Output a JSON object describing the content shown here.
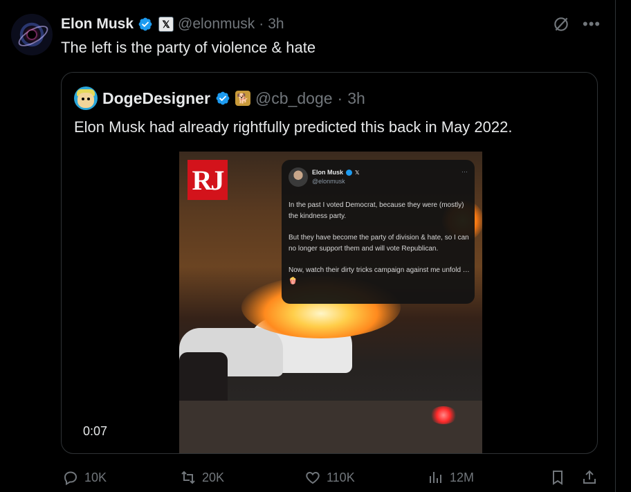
{
  "tweet": {
    "author_name": "Elon Musk",
    "handle": "@elonmusk",
    "separator": "·",
    "time": "3h",
    "affiliation_badge": "𝕏",
    "text": "The left is the party of violence & hate",
    "icons": {
      "grok": "grok-icon",
      "more": "more-icon"
    }
  },
  "quote": {
    "author_name": "DogeDesigner",
    "handle": "@cb_doge",
    "separator": "·",
    "time": "3h",
    "text": "Elon Musk had already rightfully predicted this back in May 2022.",
    "video": {
      "duration": "0:07",
      "logo": "RJ",
      "embedded_tweet": {
        "author_name": "Elon Musk",
        "handle": "@elonmusk",
        "x_mark": "𝕏",
        "more": "···",
        "paragraphs": [
          "In the past I voted Democrat, because they were (mostly) the kindness party.",
          "But they have become the party of division & hate, so I can no longer support them and will vote Republican.",
          "Now, watch their dirty tricks campaign against me unfold … 🍿"
        ]
      }
    }
  },
  "actions": {
    "replies": "10K",
    "reposts": "20K",
    "likes": "110K",
    "views": "12M"
  },
  "colors": {
    "background": "#000000",
    "text": "#e7e9ea",
    "muted": "#71767b",
    "verified": "#1d9bf0",
    "border": "#2f3336"
  }
}
